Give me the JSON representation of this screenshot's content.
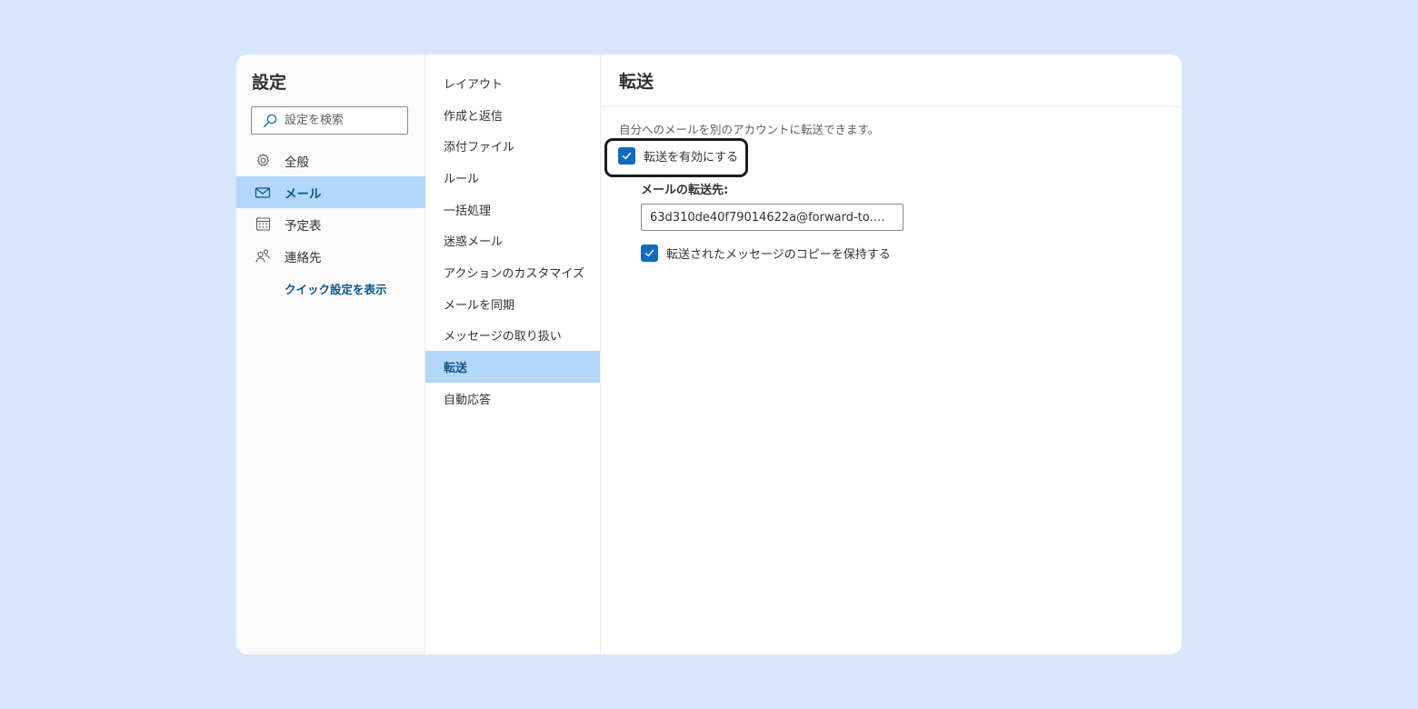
{
  "nav": {
    "title": "設定",
    "search_placeholder": "設定を検索",
    "items": [
      {
        "label": "全般",
        "icon": "gear-icon"
      },
      {
        "label": "メール",
        "icon": "mail-icon"
      },
      {
        "label": "予定表",
        "icon": "calendar-icon"
      },
      {
        "label": "連絡先",
        "icon": "people-icon"
      }
    ],
    "active_item": "メール",
    "quick_settings_link": "クイック設定を表示"
  },
  "mail_settings": {
    "items": [
      "レイアウト",
      "作成と返信",
      "添付ファイル",
      "ルール",
      "一括処理",
      "迷惑メール",
      "アクションのカスタマイズ",
      "メールを同期",
      "メッセージの取り扱い",
      "転送",
      "自動応答"
    ],
    "active_item": "転送"
  },
  "forwarding": {
    "title": "転送",
    "description": "自分へのメールを別のアカウントに転送できます。",
    "enable_label": "転送を有効にする",
    "enable_checked": true,
    "destination_label": "メールの転送先:",
    "destination_value": "63d310de40f79014622a@forward-to.…",
    "keep_copy_label": "転送されたメッセージのコピーを保持する",
    "keep_copy_checked": true
  },
  "colors": {
    "background": "#d6e6fd",
    "accent": "#0f6cbd",
    "selected": "#b3d6f9",
    "selected_text": "#0f548c"
  }
}
